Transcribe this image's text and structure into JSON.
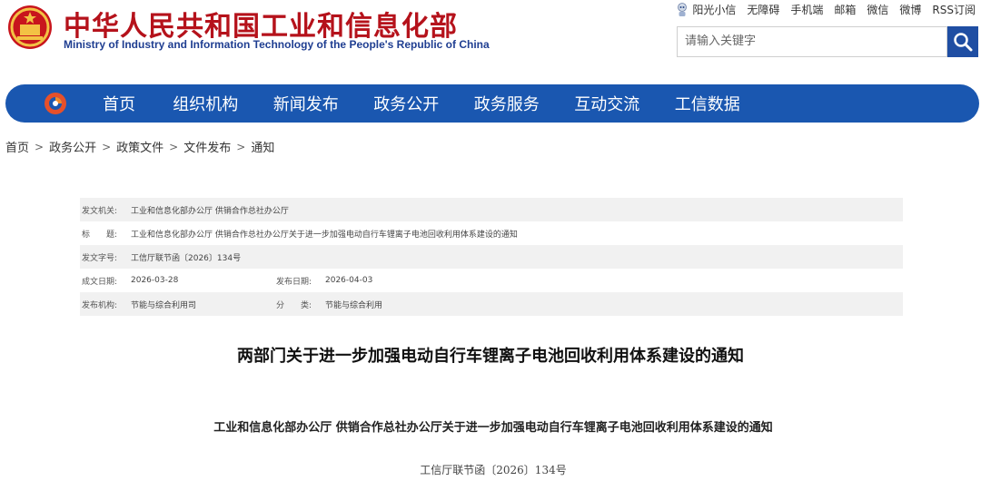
{
  "header": {
    "title_cn": "中华人民共和国工业和信息化部",
    "title_en": "Ministry of Industry and Information Technology of the People's Republic of China"
  },
  "toplinks": [
    "阳光小信",
    "无障碍",
    "手机端",
    "邮箱",
    "微信",
    "微博",
    "RSS订阅"
  ],
  "search": {
    "placeholder": "请输入关键字"
  },
  "nav": [
    "首页",
    "组织机构",
    "新闻发布",
    "政务公开",
    "政务服务",
    "互动交流",
    "工信数据"
  ],
  "breadcrumb": [
    "首页",
    "政务公开",
    "政策文件",
    "文件发布",
    "通知"
  ],
  "info": {
    "issuer_label": "发文机关:",
    "issuer": "工业和信息化部办公厅 供销合作总社办公厅",
    "title_label": "标　　题:",
    "title": "工业和信息化部办公厅 供销合作总社办公厅关于进一步加强电动自行车锂离子电池回收利用体系建设的通知",
    "docno_label": "发文字号:",
    "docno": "工信厅联节函〔2026〕134号",
    "created_label": "成文日期:",
    "created": "2026-03-28",
    "published_label": "发布日期:",
    "published": "2026-04-03",
    "org_label": "发布机构:",
    "org": "节能与综合利用司",
    "category_label": "分　　类:",
    "category": "节能与综合利用"
  },
  "article": {
    "title": "两部门关于进一步加强电动自行车锂离子电池回收利用体系建设的通知",
    "subtitle": "工业和信息化部办公厅 供销合作总社办公厅关于进一步加强电动自行车锂离子电池回收利用体系建设的通知",
    "docno": "工信厅联节函〔2026〕134号"
  },
  "colors": {
    "brand_red": "#b5121b",
    "nav_blue": "#1a57b0",
    "search_blue": "#1f4ea3"
  }
}
